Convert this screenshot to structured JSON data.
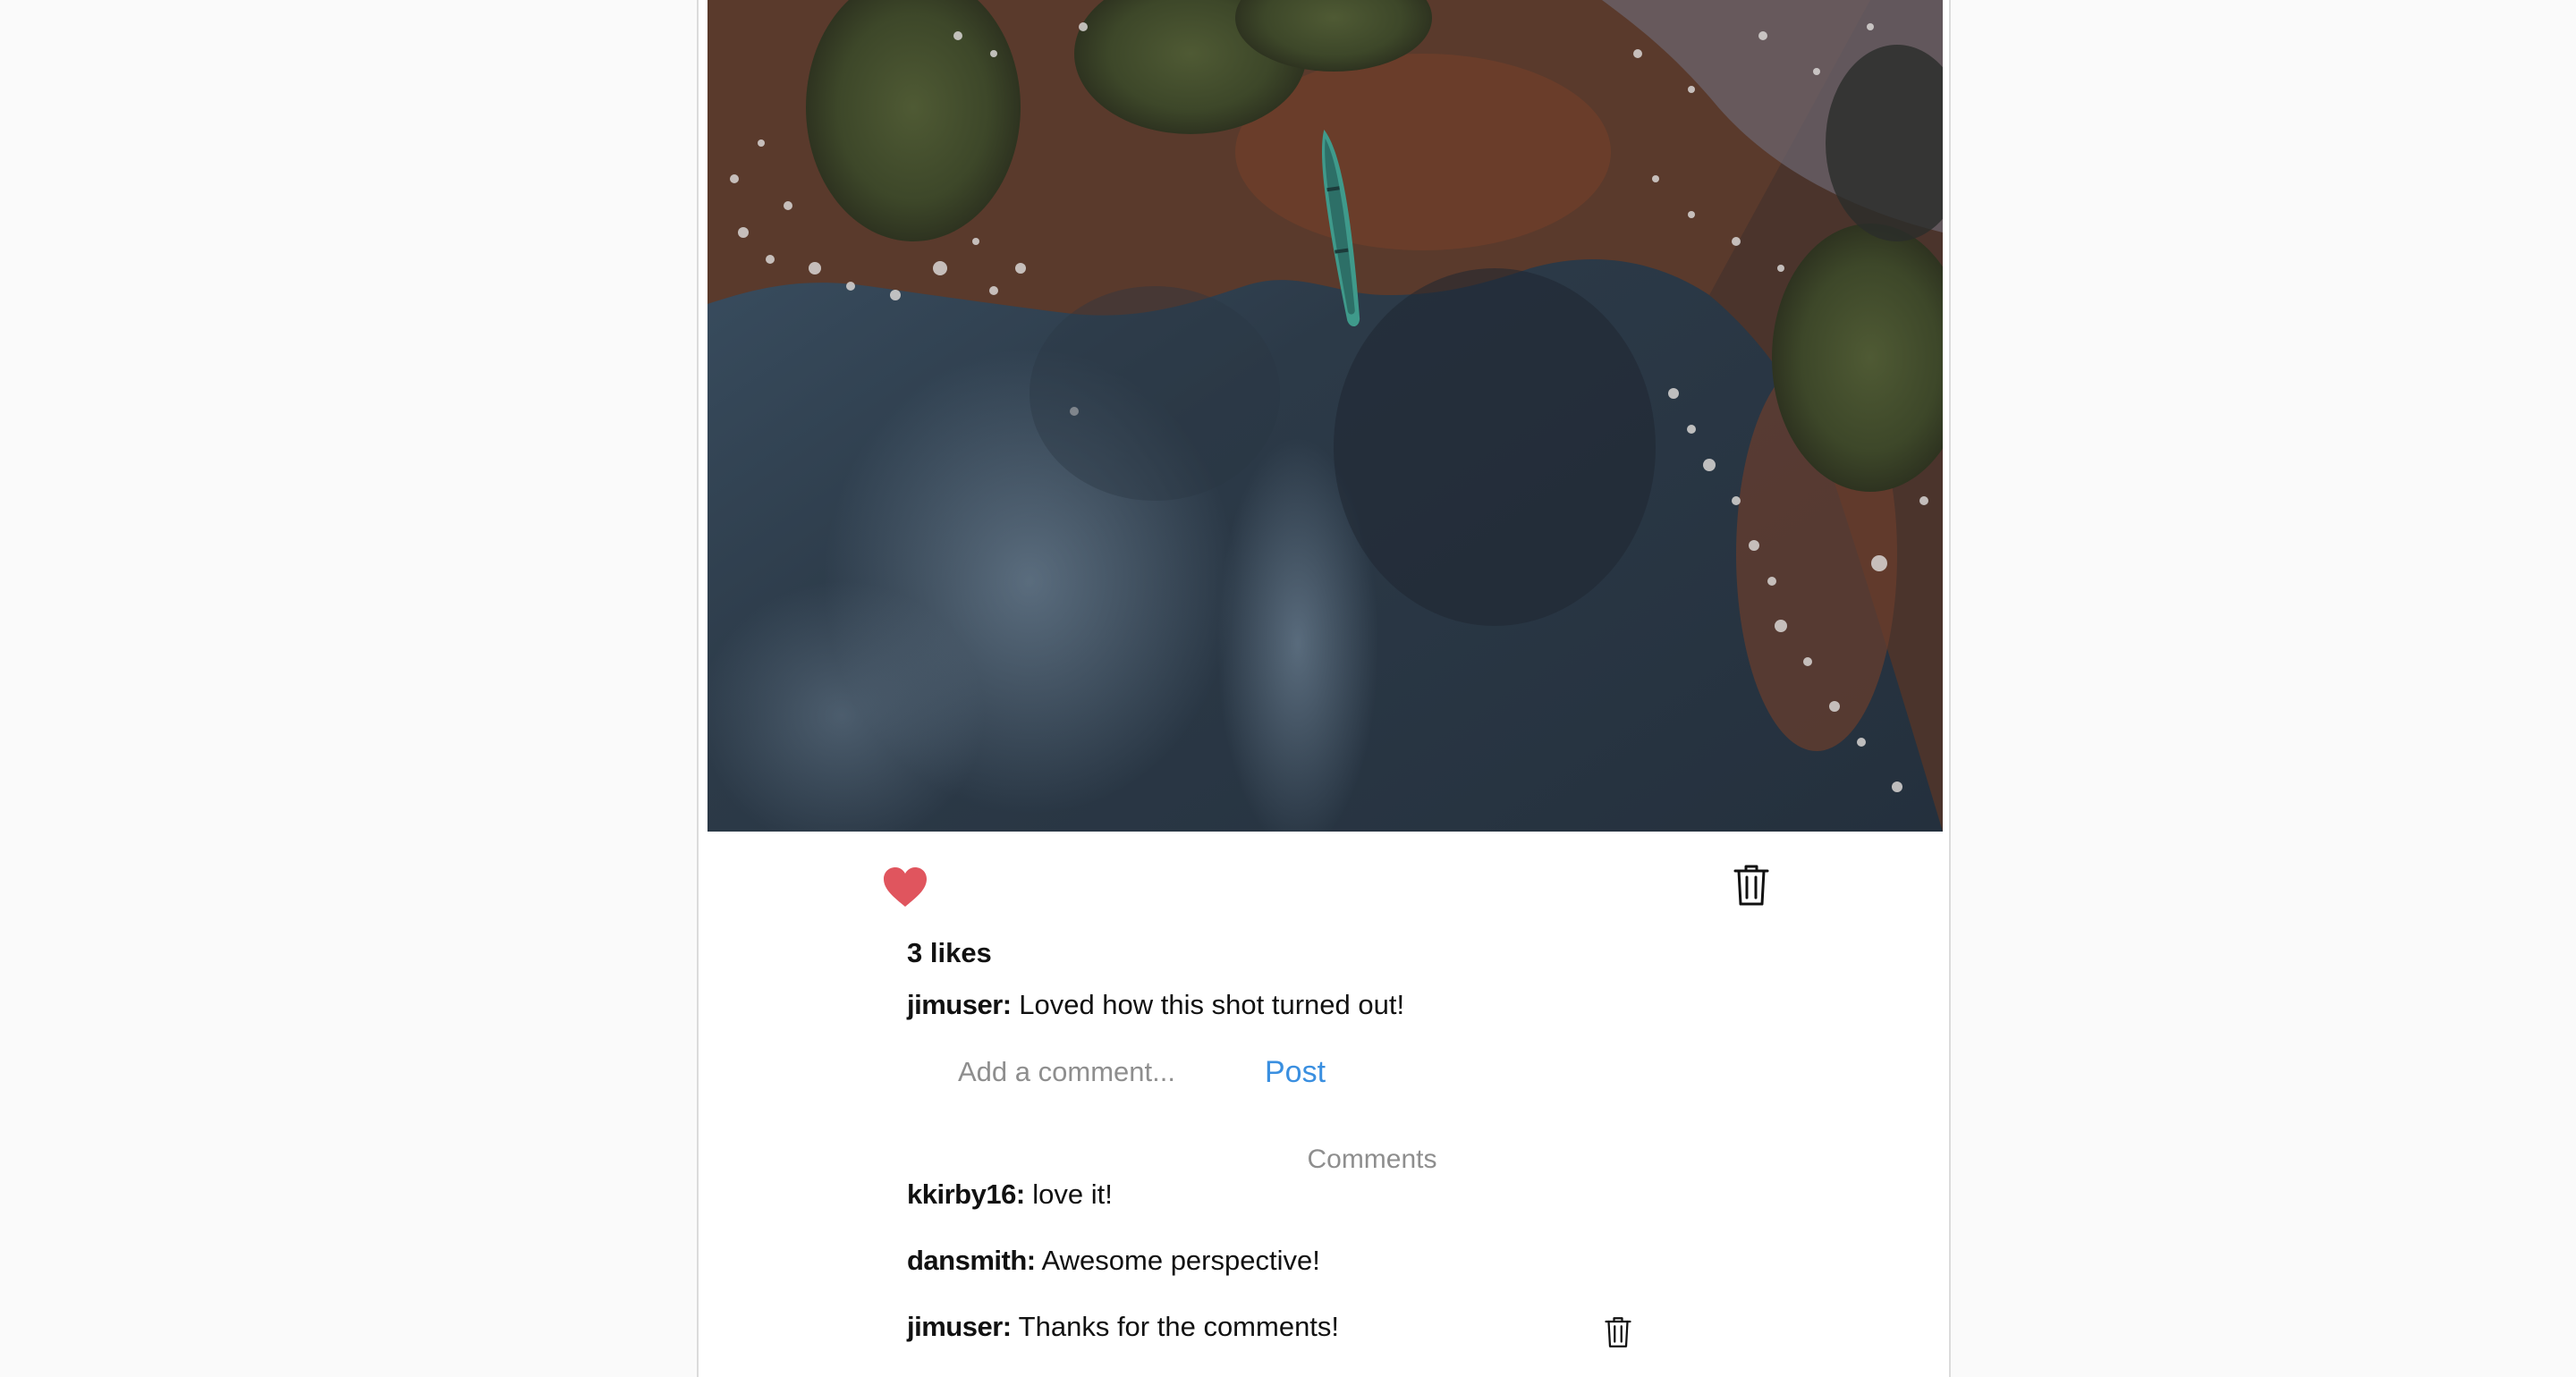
{
  "post": {
    "likes_label": "3 likes",
    "caption": {
      "username": "jimuser:",
      "text": "Loved how this shot turned out!"
    },
    "liked": true,
    "like_color": "#e0555e"
  },
  "comment_form": {
    "placeholder": "Add a comment...",
    "post_label": "Post",
    "post_color": "#3a8fe0"
  },
  "comments_section": {
    "heading": "Comments",
    "items": [
      {
        "username": "kkirby16:",
        "text": "love it!"
      },
      {
        "username": "dansmith:",
        "text": "Awesome perspective!"
      },
      {
        "username": "jimuser:",
        "text": "Thanks for the comments!",
        "deletable": true
      }
    ]
  },
  "icons": {
    "like": "heart-icon",
    "delete_post": "trash-icon",
    "delete_comment": "trash-icon"
  }
}
